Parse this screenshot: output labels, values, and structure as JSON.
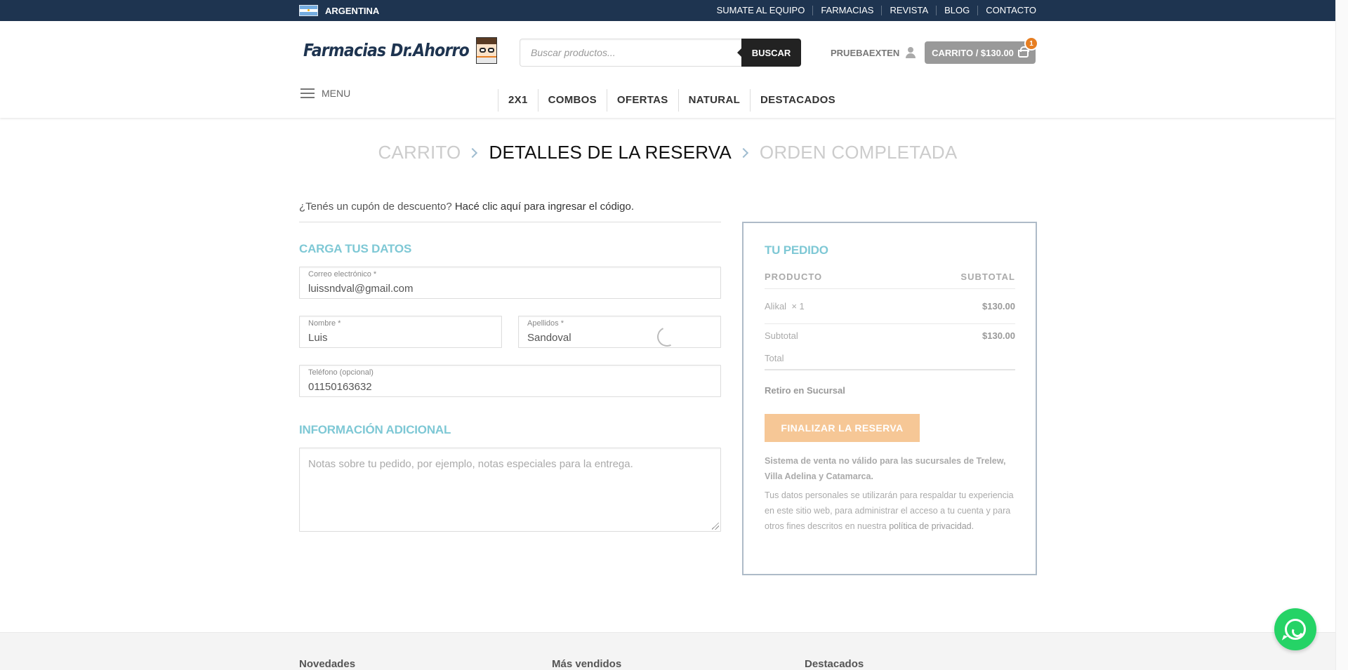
{
  "topbar": {
    "country": "ARGENTINA",
    "nav": [
      "SUMATE AL EQUIPO",
      "FARMACIAS",
      "REVISTA",
      "BLOG",
      "CONTACTO"
    ]
  },
  "header": {
    "logo_text": "Farmacias Dr.Ahorro",
    "search_placeholder": "Buscar productos...",
    "search_button": "BUSCAR",
    "account_name": "PRUEBAEXTEN",
    "cart_label": "CARRITO / $130.00",
    "cart_count": "1",
    "menu_label": "MENU",
    "categories": [
      "2X1",
      "COMBOS",
      "OFERTAS",
      "NATURAL",
      "DESTACADOS"
    ]
  },
  "steps": {
    "cart": "CARRITO",
    "details": "DETALLES DE LA RESERVA",
    "completed": "ORDEN COMPLETADA"
  },
  "coupon": {
    "question": "¿Tenés un cupón de descuento?",
    "link": "Hacé clic aquí para ingresar el código."
  },
  "billing": {
    "title": "CARGA TUS DATOS",
    "email_label": "Correo electrónico *",
    "email_value": "luissndval@gmail.com",
    "first_name_label": "Nombre *",
    "first_name_value": "Luis",
    "last_name_label": "Apellidos *",
    "last_name_value": "Sandoval",
    "phone_label": "Teléfono (opcional)",
    "phone_value": "01150163632"
  },
  "additional": {
    "title": "INFORMACIÓN ADICIONAL",
    "notes_placeholder": "Notas sobre tu pedido, por ejemplo, notas especiales para la entrega."
  },
  "order": {
    "title": "TU PEDIDO",
    "col_product": "PRODUCTO",
    "col_subtotal": "SUBTOTAL",
    "item_name": "Alikal",
    "item_qty": "× 1",
    "item_price": "$130.00",
    "subtotal_label": "Subtotal",
    "subtotal_value": "$130.00",
    "total_label": "Total",
    "shipping": "Retiro en Sucursal",
    "finalize_button": "FINALIZAR LA RESERVA",
    "notice": "Sistema de venta no válido para las sucursales de Trelew, Villa Adelina y Catamarca.",
    "privacy_text": "Tus datos personales se utilizarán para respaldar tu experiencia en este sitio web, para administrar el acceso a tu cuenta y para otros fines descritos en nuestra",
    "privacy_link": "política de privacidad."
  },
  "footer": {
    "col1": "Novedades",
    "col2": "Más vendidos",
    "col3": "Destacados"
  },
  "icons": {
    "flag": "argentina-flag-icon",
    "user": "user-icon",
    "cart": "basket-icon",
    "menu": "hamburger-icon",
    "step_separator": "chevron-right-icon",
    "whatsapp": "whatsapp-icon"
  },
  "colors": {
    "topbar_bg": "#1e3450",
    "accent_teal": "#7ec8d5",
    "finalize_button": "#f6c796",
    "cart_badge": "#e67e22",
    "whatsapp": "#25d366"
  }
}
